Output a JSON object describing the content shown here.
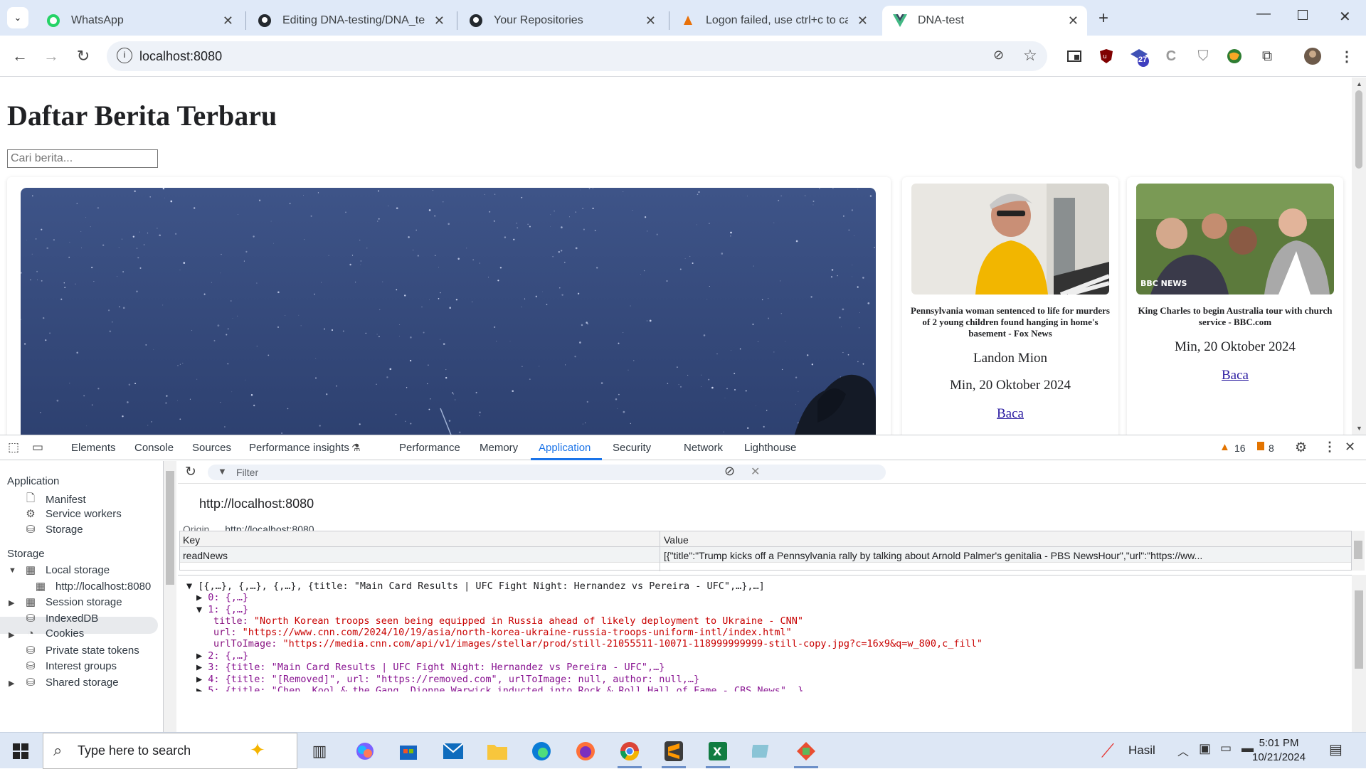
{
  "browser": {
    "tabs": [
      {
        "title": "WhatsApp",
        "icon": "whatsapp-icon"
      },
      {
        "title": "Editing DNA-testing/DNA_test/",
        "icon": "github-icon"
      },
      {
        "title": "Your Repositories",
        "icon": "github-icon"
      },
      {
        "title": "Logon failed, use ctrl+c to canc",
        "icon": "app-icon"
      },
      {
        "title": "DNA-test",
        "icon": "vue-icon",
        "active": true
      }
    ],
    "url": "localhost:8080",
    "extension_badge": "27"
  },
  "page": {
    "heading": "Daftar Berita Terbaru",
    "search_placeholder": "Cari berita...",
    "cards": [
      {
        "title": "Pennsylvania woman sentenced to life for murders of 2 young children found hanging in home's basement - Fox News",
        "author": "Landon Mion",
        "date": "Min, 20 Oktober 2024",
        "link": "Baca"
      },
      {
        "title": "King Charles to begin Australia tour with church service - BBC.com",
        "author": "",
        "date": "Min, 20 Oktober 2024",
        "link": "Baca",
        "image_watermark": "BBC NEWS"
      }
    ]
  },
  "devtools": {
    "tabs": [
      "Elements",
      "Console",
      "Sources",
      "Performance insights",
      "Performance",
      "Memory",
      "Application",
      "Security",
      "Network",
      "Lighthouse"
    ],
    "active_tab": "Application",
    "warnings": "16",
    "issues": "8",
    "sidebar": {
      "application_header": "Application",
      "application_items": [
        "Manifest",
        "Service workers",
        "Storage"
      ],
      "storage_header": "Storage",
      "local_storage": "Local storage",
      "local_storage_origin": "http://localhost:8080",
      "storage_items": [
        "Session storage",
        "IndexedDB",
        "Cookies",
        "Private state tokens",
        "Interest groups",
        "Shared storage"
      ]
    },
    "filter_placeholder": "Filter",
    "origin_title": "http://localhost:8080",
    "origin_label": "Origin",
    "origin_value": "http://localhost:8080",
    "table": {
      "key_header": "Key",
      "value_header": "Value",
      "rows": [
        {
          "key": "readNews",
          "value": "[{\"title\":\"Trump kicks off a Pennsylvania rally by talking about Arnold Palmer's genitalia - PBS NewsHour\",\"url\":\"https://ww..."
        }
      ]
    },
    "viewer": {
      "root": "[{,…}, {,…}, {,…}, {title: \"Main Card Results | UFC Fight Night: Hernandez vs Pereira - UFC\",…},…]",
      "item0": "0: {,…}",
      "item1": "1: {,…}",
      "title_key": "title:",
      "title_val": "\"North Korean troops seen being equipped in Russia ahead of likely deployment to Ukraine - CNN\"",
      "url_key": "url:",
      "url_val": "\"https://www.cnn.com/2024/10/19/asia/north-korea-ukraine-russia-troops-uniform-intl/index.html\"",
      "img_key": "urlToImage:",
      "img_val": "\"https://media.cnn.com/api/v1/images/stellar/prod/still-21055511-10071-118999999999-still-copy.jpg?c=16x9&q=w_800,c_fill\"",
      "item2": "2: {,…}",
      "item3": "3: {title: \"Main Card Results | UFC Fight Night: Hernandez vs Pereira - UFC\",…}",
      "item4": "4: {title: \"[Removed]\", url: \"https://removed.com\", urlToImage: null, author: null,…}",
      "item5": "5: {title: \"Chen, Kool & the Gang, Dionne Warwick inducted into Rock & Roll Hall of Fame - CBS News\",…}"
    }
  },
  "taskbar": {
    "search_placeholder": "Type here to search",
    "app_label": "Hasil",
    "time": "5:01 PM",
    "date": "10/21/2024"
  },
  "colors": {
    "accent": "#1a73e8",
    "tabstrip": "#dfe9f8",
    "link": "#2a1ba1",
    "string": "#c80000"
  }
}
